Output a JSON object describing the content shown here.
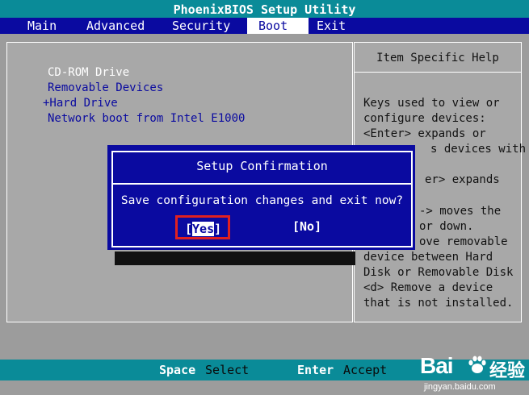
{
  "title": "PhoenixBIOS Setup Utility",
  "menu": [
    {
      "label": "Main",
      "active": false
    },
    {
      "label": "Advanced",
      "active": false
    },
    {
      "label": "Security",
      "active": false
    },
    {
      "label": "Boot",
      "active": true
    },
    {
      "label": "Exit",
      "active": false
    }
  ],
  "boot_items": [
    {
      "label": "CD-ROM Drive",
      "selected": true
    },
    {
      "label": "Removable Devices",
      "selected": false
    },
    {
      "label": "+Hard Drive",
      "selected": false
    },
    {
      "label": "Network boot from Intel E1000",
      "selected": false
    }
  ],
  "help": {
    "title": "Item Specific Help",
    "lines": [
      "Keys used to view or",
      "configure devices:",
      "<Enter> expands or",
      "s devices with",
      "er> expands",
      "-> moves the",
      "or down.",
      "ove removable",
      "device between Hard",
      "Disk or Removable Disk",
      "<d> Remove a device",
      "that is not installed."
    ]
  },
  "dialog": {
    "title": "Setup Confirmation",
    "message": "Save configuration changes and exit now?",
    "yes_label": "[Yes]",
    "yes_bracket_open": "[",
    "yes_text": "Yes",
    "yes_bracket_close": "]",
    "no_label": "[No]"
  },
  "status": {
    "space_key": "Space",
    "space_desc": "Select",
    "enter_key": "Enter",
    "enter_desc": "Accept"
  },
  "watermark": {
    "logo_text": "Bai",
    "logo_suffix": "经验",
    "url": "jingyan.baidu.com"
  },
  "colors": {
    "title_bar": "#0a8b98",
    "menu_bar": "#0a0aa0",
    "panel": "#a8a8a8",
    "dialog": "#0a0aa0",
    "highlight": "#e02020"
  }
}
